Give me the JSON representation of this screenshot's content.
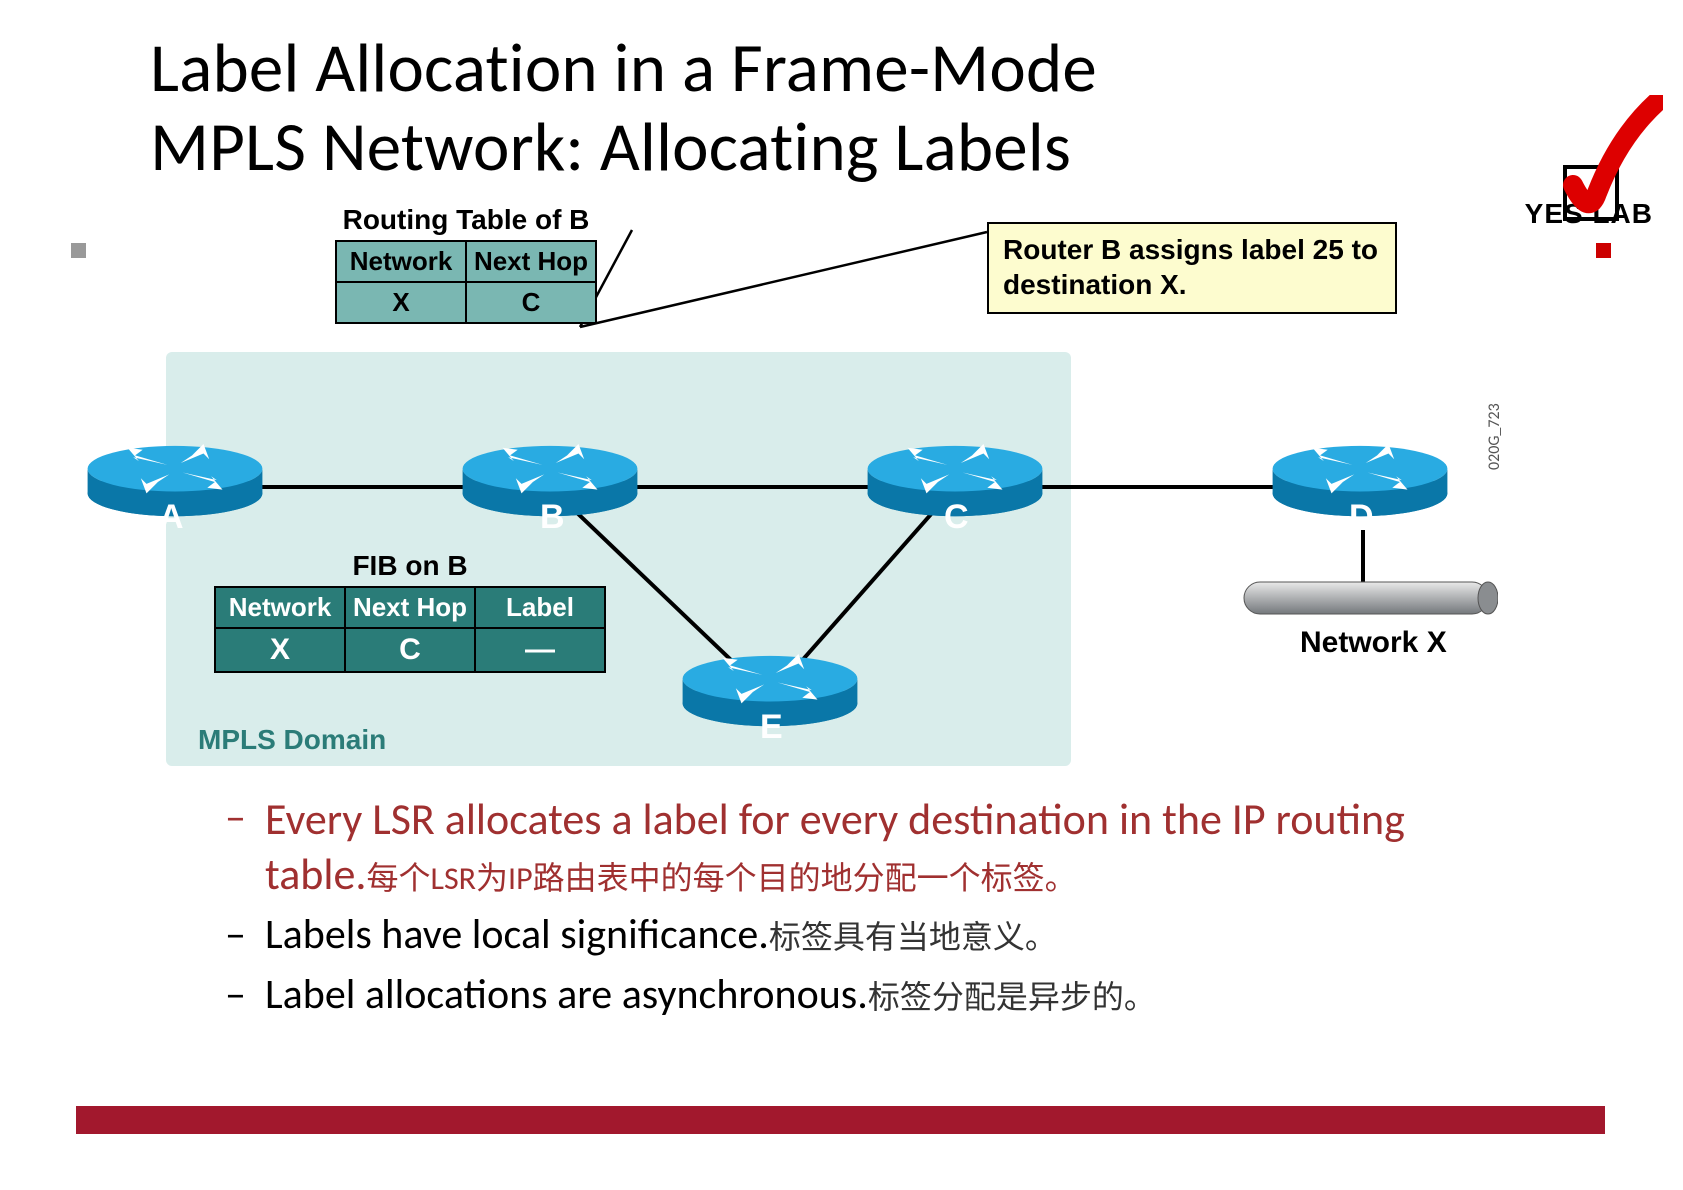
{
  "title_line1": "Label Allocation in a Frame-Mode",
  "title_line2": "MPLS Network: Allocating Labels",
  "yeslab_text": "YES LAB",
  "code_tag": "020G_723",
  "callout": "Router B assigns label 25 to destination X.",
  "mpls_domain_label": "MPLS Domain",
  "routing_table": {
    "title": "Routing Table of B",
    "headers": [
      "Network",
      "Next Hop"
    ],
    "rows": [
      [
        "X",
        "C"
      ]
    ]
  },
  "fib_table": {
    "title": "FIB on B",
    "headers": [
      "Network",
      "Next Hop",
      "Label"
    ],
    "rows": [
      [
        "X",
        "C",
        "—"
      ]
    ]
  },
  "routers": {
    "A": "A",
    "B": "B",
    "C": "C",
    "D": "D",
    "E": "E"
  },
  "network_x": "Network X",
  "bullets": [
    {
      "en": "Every LSR allocates a label for every destination in the IP routing table.",
      "zh": "每个LSR为IP路由表中的每个目的地分配一个标签。",
      "red": true
    },
    {
      "en": "Labels have local significance.",
      "zh": "标签具有当地意义。",
      "red": false
    },
    {
      "en": "Label allocations are asynchronous.",
      "zh": "标签分配是异步的。",
      "red": false
    }
  ]
}
